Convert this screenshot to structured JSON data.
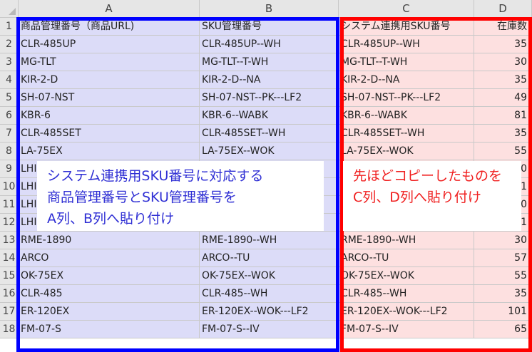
{
  "columns": [
    "A",
    "B",
    "C",
    "D"
  ],
  "rows": [
    {
      "num": "1",
      "a": "商品管理番号（商品URL)",
      "b": "SKU管理番号",
      "c": "システム連携用SKU番号",
      "d": "在庫数"
    },
    {
      "num": "2",
      "a": "CLR-485UP",
      "b": "CLR-485UP--WH",
      "c": "CLR-485UP--WH",
      "d": "35"
    },
    {
      "num": "3",
      "a": "MG-TLT",
      "b": "MG-TLT--T-WH",
      "c": "MG-TLT--T-WH",
      "d": "30"
    },
    {
      "num": "4",
      "a": "KIR-2-D",
      "b": "KIR-2-D--NA",
      "c": "KIR-2-D--NA",
      "d": "35"
    },
    {
      "num": "5",
      "a": "SH-07-NST",
      "b": "SH-07-NST--PK---LF2",
      "c": "SH-07-NST--PK---LF2",
      "d": "49"
    },
    {
      "num": "6",
      "a": "KBR-6",
      "b": "KBR-6--WABK",
      "c": "KBR-6--WABK",
      "d": "81"
    },
    {
      "num": "7",
      "a": "CLR-485SET",
      "b": "CLR-485SET--WH",
      "c": "CLR-485SET--WH",
      "d": "35"
    },
    {
      "num": "8",
      "a": "LA-75EX",
      "b": "LA-75EX--WOK",
      "c": "LA-75EX--WOK",
      "d": "55"
    },
    {
      "num": "9",
      "a": "LHI",
      "b": "",
      "c": "",
      "d": "0"
    },
    {
      "num": "10",
      "a": "LHI",
      "b": "",
      "c": "",
      "d": "1"
    },
    {
      "num": "11",
      "a": "LHI",
      "b": "",
      "c": "",
      "d": "0"
    },
    {
      "num": "12",
      "a": "LHI",
      "b": "",
      "c": "",
      "d": "1"
    },
    {
      "num": "13",
      "a": "RME-1890",
      "b": "RME-1890--WH",
      "c": "RME-1890--WH",
      "d": "30"
    },
    {
      "num": "14",
      "a": "ARCO",
      "b": "ARCO--TU",
      "c": "ARCO--TU",
      "d": "57"
    },
    {
      "num": "15",
      "a": "OK-75EX",
      "b": "OK-75EX--WOK",
      "c": "OK-75EX--WOK",
      "d": "55"
    },
    {
      "num": "16",
      "a": "CLR-485",
      "b": "CLR-485--WH",
      "c": "CLR-485--WH",
      "d": "35"
    },
    {
      "num": "17",
      "a": "ER-120EX",
      "b": "ER-120EX--WOK---LF2",
      "c": "ER-120EX--WOK---LF2",
      "d": "101"
    },
    {
      "num": "18",
      "a": "FM-07-S",
      "b": "FM-07-S--IV",
      "c": "FM-07-S--IV",
      "d": "65"
    }
  ],
  "callouts": {
    "blue": [
      "システム連携用SKU番号に対応する",
      "商品管理番号とSKU管理番号を",
      "A列、B列へ貼り付け"
    ],
    "red": [
      "先ほどコピーしたものを",
      "C列、D列へ貼り付け"
    ]
  },
  "colors": {
    "blue_frame": "#0000ff",
    "red_frame": "#ff0000",
    "blue_fill": "#dcdcf8",
    "red_fill": "#fde0e0",
    "blue_text": "#2f2fd4",
    "red_text": "#f02020"
  }
}
